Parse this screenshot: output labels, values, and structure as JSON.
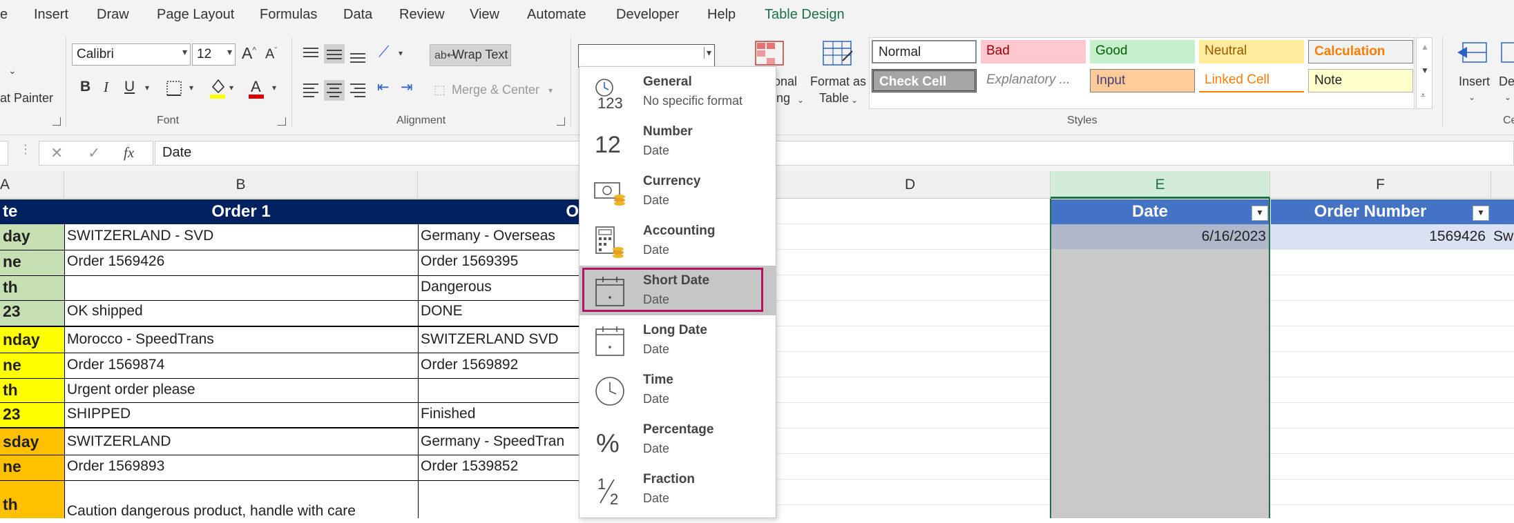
{
  "menu": {
    "tabs": [
      "e",
      "Insert",
      "Draw",
      "Page Layout",
      "Formulas",
      "Data",
      "Review",
      "View",
      "Automate",
      "Developer",
      "Help",
      "Table Design"
    ],
    "selected": "Table Design"
  },
  "ribbon": {
    "clipboard": {
      "format_painter": "at Painter"
    },
    "font": {
      "label": "Font",
      "name": "Calibri",
      "size": "12",
      "bold": "B",
      "italic": "I",
      "underline": "U",
      "grow": "A",
      "shrink": "A"
    },
    "alignment": {
      "label": "Alignment",
      "wrap_text": "Wrap Text",
      "merge_center": "Merge & Center"
    },
    "number": {
      "format_value": ""
    },
    "cond_format": {
      "line1": "onal",
      "line2": "ing"
    },
    "format_table": {
      "line1": "Format as",
      "line2": "Table"
    },
    "styles": {
      "label": "Styles",
      "row1": [
        "Normal",
        "Bad",
        "Good",
        "Neutral",
        "Calculation"
      ],
      "row2": [
        "Check Cell",
        "Explanatory ...",
        "Input",
        "Linked Cell",
        "Note"
      ]
    },
    "cells": {
      "insert": "Insert",
      "delete": "De",
      "label": "Ce"
    }
  },
  "formula_bar": {
    "fx": "fx",
    "value": "Date"
  },
  "columns": [
    "A",
    "B",
    "D",
    "E",
    "F"
  ],
  "table_left": {
    "header": {
      "a": "te",
      "b": "Order 1",
      "c": "O"
    },
    "rows": [
      {
        "a": "day",
        "b": "SWITZERLAND - SVD",
        "c": "Germany - Overseas"
      },
      {
        "a": "ne",
        "b": "Order 1569426",
        "c": "Order 1569395"
      },
      {
        "a": "th",
        "b": "",
        "c": "Dangerous"
      },
      {
        "a": "23",
        "b": "OK shipped",
        "c": "DONE"
      },
      {
        "a": "nday",
        "b": "Morocco - SpeedTrans",
        "c": "SWITZERLAND SVD"
      },
      {
        "a": "ne",
        "b": "Order 1569874",
        "c": "Order 1569892"
      },
      {
        "a": "th",
        "b": "Urgent order please",
        "c": ""
      },
      {
        "a": "23",
        "b": "SHIPPED",
        "c": "Finished"
      },
      {
        "a": "sday",
        "b": "SWITZERLAND",
        "c": "Germany - SpeedTran"
      },
      {
        "a": "ne",
        "b": "Order 1569893",
        "c": "Order 1539852"
      },
      {
        "a": "th",
        "b": "Caution dangerous product, handle with care",
        "c": ""
      }
    ]
  },
  "table_right": {
    "headers": [
      "Date",
      "Order Number"
    ],
    "row1": {
      "date": "6/16/2023",
      "order": "1569426",
      "next": "Sw"
    }
  },
  "number_format_dropdown": {
    "items": [
      {
        "name": "General",
        "sub": "No specific format",
        "icon": "clock-123-icon"
      },
      {
        "name": "Number",
        "sub": "Date",
        "icon": "number-12-icon"
      },
      {
        "name": "Currency",
        "sub": "Date",
        "icon": "currency-icon"
      },
      {
        "name": "Accounting",
        "sub": " Date",
        "icon": "accounting-icon"
      },
      {
        "name": "Short Date",
        "sub": "Date",
        "icon": "calendar-icon"
      },
      {
        "name": "Long Date",
        "sub": "Date",
        "icon": "calendar-icon"
      },
      {
        "name": "Time",
        "sub": "Date",
        "icon": "clock-icon"
      },
      {
        "name": "Percentage",
        "sub": "Date",
        "icon": "percent-icon"
      },
      {
        "name": "Fraction",
        "sub": "Date",
        "icon": "fraction-icon"
      }
    ],
    "selected": "Short Date"
  },
  "colors": {
    "header_navy": "#002060",
    "table_blue": "#4472c4",
    "green_fill": "#c6e0b4",
    "yellow_fill": "#ffff00",
    "orange_fill": "#ffc000",
    "highlight_border": "#b4135f",
    "selection_green": "#1e7145"
  }
}
